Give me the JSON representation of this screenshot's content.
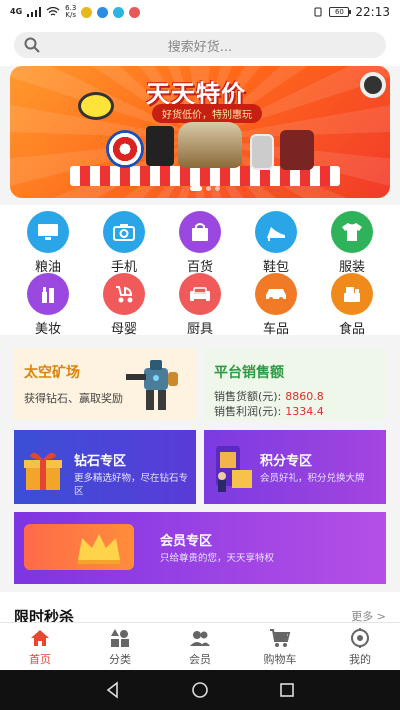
{
  "status_bar": {
    "network": "4G",
    "speed_value": "6.3",
    "speed_unit": "K/s",
    "battery": "60",
    "time": "22:13"
  },
  "search": {
    "placeholder": "搜索好货..."
  },
  "banner": {
    "title": "天天特价",
    "tagline": "好货低价，特别惠玩"
  },
  "categories": [
    {
      "label": "粮油",
      "color": "#2aa5e8",
      "icon": "monitor-icon"
    },
    {
      "label": "手机",
      "color": "#2aa5e8",
      "icon": "camera-icon"
    },
    {
      "label": "百货",
      "color": "#9b48e0",
      "icon": "shopping-bag-icon"
    },
    {
      "label": "鞋包",
      "color": "#2aa5e8",
      "icon": "high-heel-icon"
    },
    {
      "label": "服装",
      "color": "#2fb35a",
      "icon": "tshirt-icon"
    },
    {
      "label": "美妆",
      "color": "#9b48e0",
      "icon": "cosmetics-icon"
    },
    {
      "label": "母婴",
      "color": "#f05a5a",
      "icon": "stroller-icon"
    },
    {
      "label": "厨具",
      "color": "#f05a5a",
      "icon": "sofa-icon"
    },
    {
      "label": "车品",
      "color": "#f07a26",
      "icon": "car-icon"
    },
    {
      "label": "食品",
      "color": "#f08a1a",
      "icon": "food-icon"
    }
  ],
  "space_mine": {
    "title": "太空矿场",
    "subtitle": "获得钻石、赢取奖励"
  },
  "sales": {
    "title": "平台销售额",
    "rows": [
      {
        "label": "销售货额(元):",
        "value": "8860.8"
      },
      {
        "label": "销售利润(元):",
        "value": "1334.4"
      }
    ]
  },
  "diamond_zone": {
    "title": "钻石专区",
    "desc": "更多精选好物，尽在钻石专区"
  },
  "points_zone": {
    "title": "积分专区",
    "desc": "会员好礼，积分兑换大牌"
  },
  "member_zone": {
    "title": "会员专区",
    "desc": "只给尊贵的您，天天享特权"
  },
  "flash_sale": {
    "title": "限时秒杀",
    "more": "更多 >"
  },
  "tabs": [
    {
      "label": "首页",
      "icon": "home-icon",
      "active": true
    },
    {
      "label": "分类",
      "icon": "category-icon",
      "active": false
    },
    {
      "label": "会员",
      "icon": "member-icon",
      "active": false
    },
    {
      "label": "购物车",
      "icon": "cart-icon",
      "active": false
    },
    {
      "label": "我的",
      "icon": "profile-icon",
      "active": false
    }
  ],
  "colors": {
    "accent": "#e8462f",
    "diamond_bg": "#3b4fd6",
    "points_bg": "#7b3be0",
    "member_bg": "#8a3ae2"
  }
}
